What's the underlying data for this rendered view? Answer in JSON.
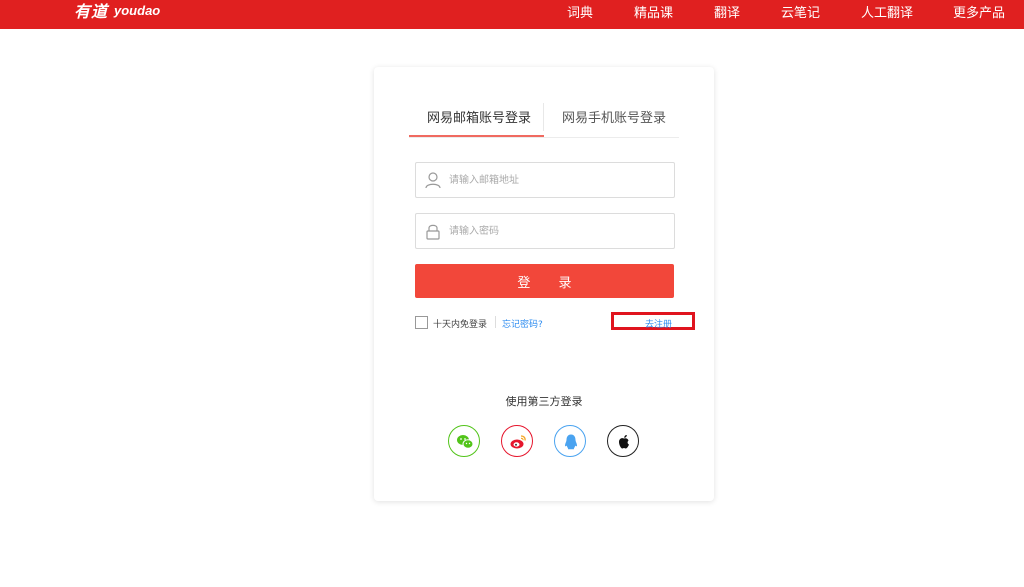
{
  "header": {
    "logo_cn": "有道",
    "logo_en": "youdao",
    "nav": [
      "词典",
      "精品课",
      "翻译",
      "云笔记",
      "人工翻译",
      "更多产品"
    ]
  },
  "login": {
    "tabs": [
      "网易邮箱账号登录",
      "网易手机账号登录"
    ],
    "email_placeholder": "请输入邮箱地址",
    "password_placeholder": "请输入密码",
    "login_label": "登 录",
    "remember_label": "十天内免登录",
    "forgot_label": "忘记密码?",
    "register_label": "去注册",
    "third_party_title": "使用第三方登录",
    "social_icons": [
      "wechat-icon",
      "weibo-icon",
      "qq-icon",
      "apple-icon"
    ]
  },
  "colors": {
    "brand_red": "#e02020",
    "button_red": "#f2473a",
    "link_blue": "#2d8cf0",
    "highlight_red": "#e0141e"
  }
}
